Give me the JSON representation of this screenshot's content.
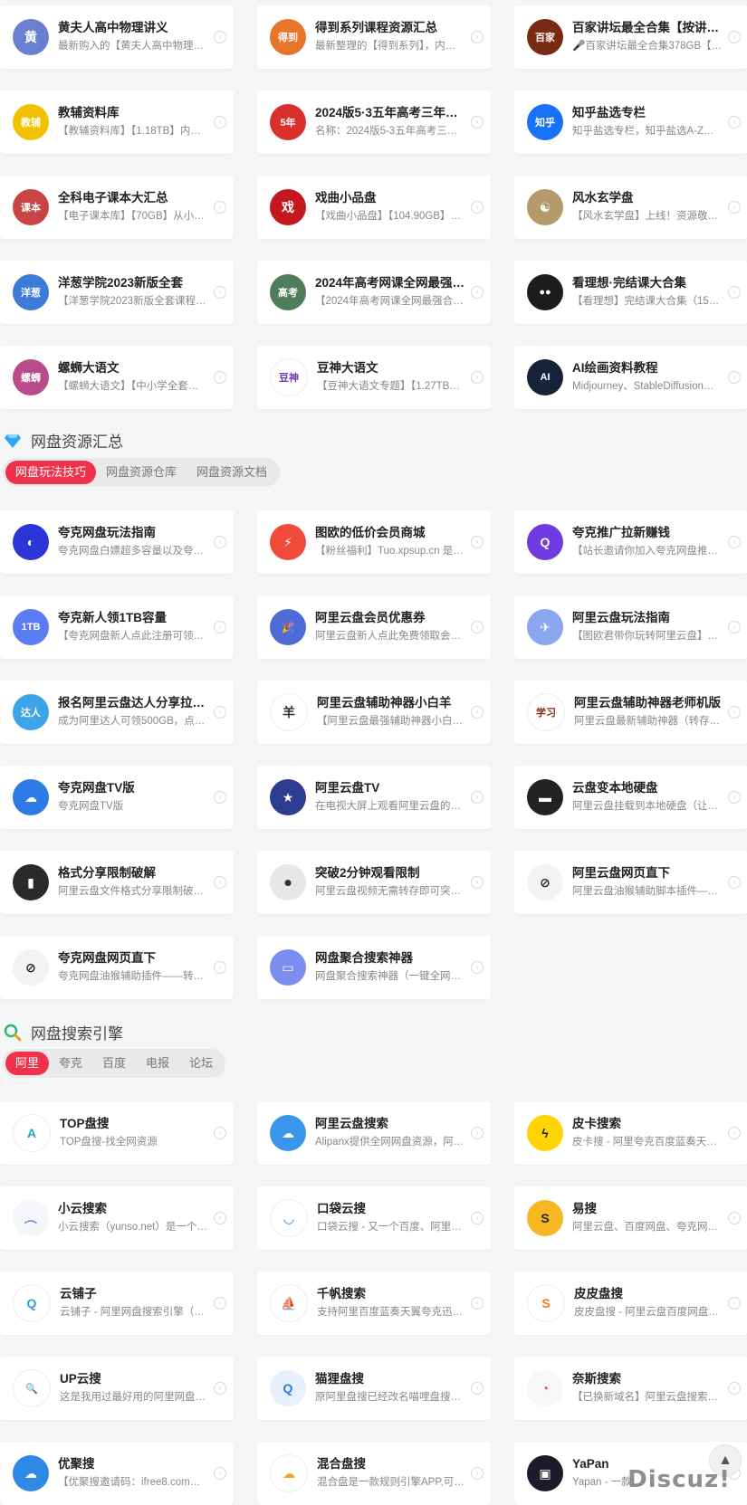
{
  "top_cards": [
    {
      "title": "黄夫人高中物理讲义",
      "desc": "最新购入的【黄夫人高中物理…",
      "color": "#6a7fd0",
      "glyph": "黄"
    },
    {
      "title": "得到系列课程资源汇总",
      "desc": "最新整理的【得到系列】，内…",
      "color": "#e8742b",
      "glyph": "得到"
    },
    {
      "title": "百家讲坛最全合集【按讲…",
      "desc": "🎤百家讲坛最全合集378GB【…",
      "color": "#7a2a12",
      "glyph": "百家"
    },
    {
      "title": "教辅资料库",
      "desc": "【教辅资料库】【1.18TB】内…",
      "color": "#f2c200",
      "glyph": "教辅"
    },
    {
      "title": "2024版5·3五年高考三年模…",
      "desc": "名称：2024版5-3五年高考三年…",
      "color": "#d9302c",
      "glyph": "5年"
    },
    {
      "title": "知乎盐选专栏",
      "desc": "知乎盐选专栏，知乎盐选A-Z大…",
      "color": "#1772f6",
      "glyph": "知乎"
    },
    {
      "title": "全科电子课本大汇总",
      "desc": "【电子课本库】【70GB】从小…",
      "color": "#c94444",
      "glyph": "课本"
    },
    {
      "title": "戏曲小品盘",
      "desc": "【戏曲小品盘】【104.90GB】…",
      "color": "#c4181e",
      "glyph": "戏"
    },
    {
      "title": "风水玄学盘",
      "desc": "【风水玄学盘】上线！资源敬…",
      "color": "#b49a6a",
      "glyph": "☯"
    },
    {
      "title": "洋葱学院2023新版全套",
      "desc": "【洋葱学院2023新版全套课程…",
      "color": "#3d7bd9",
      "glyph": "洋葱"
    },
    {
      "title": "2024年高考网课全网最强…",
      "desc": "【2024年高考网课全网最强合…",
      "color": "#4f7d5a",
      "glyph": "高考"
    },
    {
      "title": "看理想·完结课大合集",
      "desc": "【看理想】完结课大合集（157…",
      "color": "#1c1c1c",
      "glyph": "●●"
    },
    {
      "title": "螺蛳大语文",
      "desc": "【螺蛳大语文】【中小学全套…",
      "color": "#b84c8d",
      "glyph": "螺蛳"
    },
    {
      "title": "豆神大语文",
      "desc": "【豆神大语文专题】【1.27TB…",
      "color": "#ffffff",
      "glyph": "豆神",
      "fg": "#6a3aa8"
    },
    {
      "title": "AI绘画资料教程",
      "desc": "Midjourney、StableDiffusion与…",
      "color": "#162238",
      "glyph": "AI"
    }
  ],
  "section_pan": {
    "title": "网盘资源汇总",
    "icon": "diamond-icon",
    "tabs": [
      "网盘玩法技巧",
      "网盘资源仓库",
      "网盘资源文档"
    ],
    "active_tab": "网盘玩法技巧",
    "cards": [
      {
        "title": "夸克网盘玩法指南",
        "desc": "夸克网盘白嫖超多容量以及夸…",
        "color": "#2b35d8",
        "glyph": "◐"
      },
      {
        "title": "图欧的低价会员商城",
        "desc": "【粉丝福利】Tuo.xpsup.cn 是…",
        "color": "#f04b3a",
        "glyph": "⚡"
      },
      {
        "title": "夸克推广拉新赚钱",
        "desc": "【站长邀请你加入夸克网盘推…",
        "color": "#6d3be0",
        "glyph": "Q"
      },
      {
        "title": "夸克新人领1TB容量",
        "desc": "【夸克网盘新人点此注册可领1…",
        "color": "#5b7cf2",
        "glyph": "1TB"
      },
      {
        "title": "阿里云盘会员优惠券",
        "desc": "阿里云盘新人点此免费领取会…",
        "color": "#4e6bd6",
        "glyph": "🎉"
      },
      {
        "title": "阿里云盘玩法指南",
        "desc": "【图欧君带你玩转阿里云盘】…",
        "color": "#8aa6f0",
        "glyph": "✈"
      },
      {
        "title": "报名阿里云盘达人分享拉…",
        "desc": "成为阿里达人可领500GB，点…",
        "color": "#3ca4e8",
        "glyph": "达人"
      },
      {
        "title": "阿里云盘辅助神器小白羊",
        "desc": "【阿里云盘最强辅助神器小白…",
        "color": "#ffffff",
        "glyph": "羊",
        "fg": "#333"
      },
      {
        "title": "阿里云盘辅助神器老师机版",
        "desc": "阿里云盘最新辅助神器（转存+…",
        "color": "#ffffff",
        "glyph": "学习",
        "fg": "#8a2b18"
      },
      {
        "title": "夸克网盘TV版",
        "desc": "夸克网盘TV版",
        "color": "#2e7be6",
        "glyph": "☁"
      },
      {
        "title": "阿里云盘TV",
        "desc": "在电视大屏上观看阿里云盘的…",
        "color": "#2c3c8f",
        "glyph": "★"
      },
      {
        "title": "云盘变本地硬盘",
        "desc": "阿里云盘挂载到本地硬盘（让…",
        "color": "#222222",
        "glyph": "▬"
      },
      {
        "title": "格式分享限制破解",
        "desc": "阿里云盘文件格式分享限制破…",
        "color": "#2a2a2a",
        "glyph": "▮"
      },
      {
        "title": "突破2分钟观看限制",
        "desc": "阿里云盘视频无需转存即可突…",
        "color": "#e7e7e7",
        "glyph": "⏺",
        "fg": "#333"
      },
      {
        "title": "阿里云盘网页直下",
        "desc": "阿里云盘油猴辅助脚本插件—…",
        "color": "#f3f3f3",
        "glyph": "⊘",
        "fg": "#222"
      },
      {
        "title": "夸克网盘网页直下",
        "desc": "夸克网盘油猴辅助插件——转…",
        "color": "#f3f3f3",
        "glyph": "⊘",
        "fg": "#222"
      },
      {
        "title": "网盘聚合搜索神器",
        "desc": "网盘聚合搜索神器（一键全网…",
        "color": "#7b8ef0",
        "glyph": "▭"
      }
    ]
  },
  "section_search": {
    "title": "网盘搜索引擎",
    "icon": "magnifier-icon",
    "tabs": [
      "阿里",
      "夸克",
      "百度",
      "电报",
      "论坛"
    ],
    "active_tab": "阿里",
    "cards": [
      {
        "title": "TOP盘搜",
        "desc": "TOP盘搜-找全网资源",
        "color": "#ffffff",
        "glyph": "A",
        "fg": "#1aa9c7"
      },
      {
        "title": "阿里云盘搜索",
        "desc": "Alipanx提供全网网盘资源，阿…",
        "color": "#3a96ea",
        "glyph": "☁"
      },
      {
        "title": "皮卡搜索",
        "desc": "皮卡搜 - 阿里夸克百度蓝奏天…",
        "color": "#ffd400",
        "glyph": "ϟ",
        "fg": "#222"
      },
      {
        "title": "小云搜索",
        "desc": "小云搜索（yunso.net）是一个…",
        "color": "#f4f6fa",
        "glyph": "︵",
        "fg": "#5a8fe0"
      },
      {
        "title": "口袋云搜",
        "desc": "口袋云搜 - 又一个百度、阿里…",
        "color": "#ffffff",
        "glyph": "◡",
        "fg": "#1d8fe0"
      },
      {
        "title": "易搜",
        "desc": "阿里云盘、百度网盘、夸克网…",
        "color": "#f6b820",
        "glyph": "S",
        "fg": "#222"
      },
      {
        "title": "云铺子",
        "desc": "云铺子 - 阿里网盘搜索引擎（…",
        "color": "#ffffff",
        "glyph": "Q",
        "fg": "#2a9ce0"
      },
      {
        "title": "千帆搜索",
        "desc": "支持阿里百度蓝奏天翼夸克迅…",
        "color": "#ffffff",
        "glyph": "⛵",
        "fg": "#f2a20c"
      },
      {
        "title": "皮皮盘搜",
        "desc": "皮皮盘搜 - 阿里云盘百度网盘…",
        "color": "#ffffff",
        "glyph": "S",
        "fg": "#f07a1c"
      },
      {
        "title": "UP云搜",
        "desc": "这是我用过最好用的阿里网盘…",
        "color": "#ffffff",
        "glyph": "🔍",
        "fg": "#2c7be0"
      },
      {
        "title": "猫狸盘搜",
        "desc": "原阿里盘搜已经改名喵哩盘搜…",
        "color": "#e8f0fb",
        "glyph": "Q",
        "fg": "#2c7be0"
      },
      {
        "title": "奈斯搜索",
        "desc": "【已换新域名】阿里云盘搜索…",
        "color": "#f7f7f7",
        "glyph": "◔",
        "fg": "#e24a3a"
      },
      {
        "title": "优聚搜",
        "desc": "【优聚搜邀请码：ifree8.com】…",
        "color": "#2d88e6",
        "glyph": "☁"
      },
      {
        "title": "混合盘搜",
        "desc": "混合盘是一款规则引擎APP,可…",
        "color": "#ffffff",
        "glyph": "☁",
        "fg": "#f4a31c"
      },
      {
        "title": "YaPan",
        "desc": "Yapan - 一款…",
        "color": "#1b1b2a",
        "glyph": "▣"
      }
    ]
  },
  "floating": {
    "back_to_top": "▲",
    "watermark": "Discuz!"
  }
}
